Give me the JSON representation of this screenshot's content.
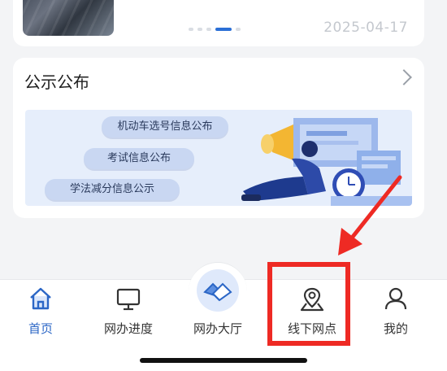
{
  "news": {
    "date": "2025-04-17",
    "carousel_total": 5,
    "carousel_active_index": 3
  },
  "announcements": {
    "title": "公示公布",
    "items": [
      "机动车选号信息公布",
      "考试信息公布",
      "学法减分信息公示"
    ]
  },
  "tabbar": {
    "tabs": [
      {
        "label": "首页",
        "icon": "home-icon",
        "active": true
      },
      {
        "label": "网办进度",
        "icon": "monitor-icon",
        "active": false
      },
      {
        "label": "网办大厅",
        "icon": "handshake-icon",
        "active": false
      },
      {
        "label": "线下网点",
        "icon": "map-pin-icon",
        "active": false
      },
      {
        "label": "我的",
        "icon": "user-icon",
        "active": false
      }
    ]
  },
  "colors": {
    "accent": "#2b66c6",
    "highlight": "#ee2a24"
  }
}
